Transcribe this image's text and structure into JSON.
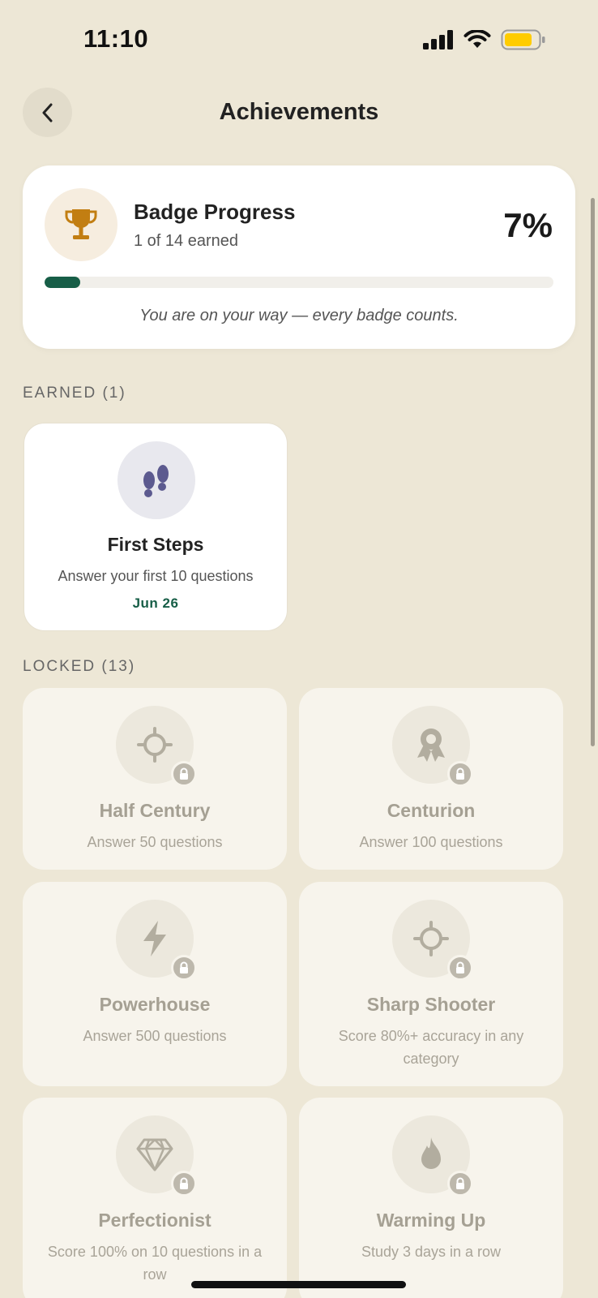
{
  "status_bar": {
    "time": "11:10",
    "battery_color": "#FFCC00"
  },
  "header": {
    "title": "Achievements",
    "back_icon": "chevron-left-icon"
  },
  "progress": {
    "title": "Badge Progress",
    "subtitle": "1 of 14 earned",
    "percent_label": "7%",
    "percent_value": 0.07,
    "message": "You are on your way — every badge counts.",
    "icon": "trophy-icon",
    "accent_color": "#175E47",
    "trophy_color": "#C27E12"
  },
  "earned": {
    "label": "EARNED (1)",
    "badges": [
      {
        "name": "First Steps",
        "desc": "Answer your first 10 questions",
        "date": "Jun 26",
        "icon": "footprints-icon",
        "icon_color": "#5C5A8F"
      }
    ]
  },
  "locked": {
    "label": "LOCKED (13)",
    "badges": [
      {
        "name": "Half Century",
        "desc": "Answer 50 questions",
        "icon": "crosshair-icon"
      },
      {
        "name": "Centurion",
        "desc": "Answer 100 questions",
        "icon": "award-ribbon-icon"
      },
      {
        "name": "Powerhouse",
        "desc": "Answer 500 questions",
        "icon": "lightning-icon"
      },
      {
        "name": "Sharp Shooter",
        "desc": "Score 80%+ accuracy in any category",
        "icon": "crosshair-icon"
      },
      {
        "name": "Perfectionist",
        "desc": "Score 100% on 10 questions in a row",
        "icon": "diamond-icon"
      },
      {
        "name": "Warming Up",
        "desc": "Study 3 days in a row",
        "icon": "flame-icon"
      }
    ]
  }
}
